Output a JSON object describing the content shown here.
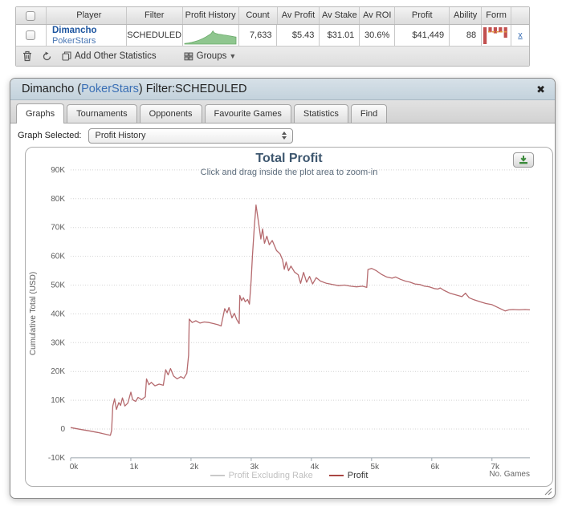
{
  "table": {
    "columns": [
      "Player",
      "Filter",
      "Profit History",
      "Count",
      "Av Profit",
      "Av Stake",
      "Av ROI",
      "Profit",
      "Ability",
      "Form"
    ],
    "row": {
      "player_name": "Dimancho",
      "site": "PokerStars",
      "filter": "SCHEDULED",
      "count": "7,633",
      "av_profit": "$5.43",
      "av_stake": "$31.01",
      "av_roi": "30.6%",
      "profit": "$41,449",
      "ability": "88",
      "remove_label": "x"
    },
    "toolbar": {
      "add_other_statistics": "Add Other Statistics",
      "groups": "Groups"
    },
    "sparkline": {
      "color_fill": "#8fc68f",
      "color_stroke": "#6aaa6a",
      "points": [
        [
          0,
          0.04
        ],
        [
          0.07,
          0.07
        ],
        [
          0.14,
          0.11
        ],
        [
          0.2,
          0.16
        ],
        [
          0.26,
          0.22
        ],
        [
          0.31,
          0.28
        ],
        [
          0.36,
          0.36
        ],
        [
          0.41,
          0.44
        ],
        [
          0.45,
          0.52
        ],
        [
          0.49,
          0.6
        ],
        [
          0.52,
          0.68
        ],
        [
          0.55,
          0.82
        ],
        [
          0.57,
          0.72
        ],
        [
          0.61,
          0.66
        ],
        [
          0.66,
          0.62
        ],
        [
          0.71,
          0.6
        ],
        [
          0.76,
          0.57
        ],
        [
          0.81,
          0.55
        ],
        [
          0.86,
          0.52
        ],
        [
          0.91,
          0.49
        ],
        [
          0.96,
          0.46
        ],
        [
          1,
          0.44
        ]
      ]
    },
    "form_chart": {
      "bar_color": "#c2504f",
      "dash_color": "#e39c3f",
      "bars": [
        1.0,
        0.3,
        0.36,
        0.3,
        0.62
      ],
      "dash_y": 0.27
    }
  },
  "dialog": {
    "title_prefix": "Dimancho (",
    "title_site": "PokerStars",
    "title_suffix": ") Filter:SCHEDULED",
    "close_label": "✖",
    "tabs": [
      {
        "label": "Graphs",
        "active": true
      },
      {
        "label": "Tournaments",
        "active": false
      },
      {
        "label": "Opponents",
        "active": false
      },
      {
        "label": "Favourite Games",
        "active": false
      },
      {
        "label": "Statistics",
        "active": false
      },
      {
        "label": "Find",
        "active": false
      }
    ],
    "graph_selected_label": "Graph Selected:",
    "graph_selected_value": "Profit History"
  },
  "chart_data": {
    "type": "line",
    "title": "Total Profit",
    "subtitle": "Click and drag inside the plot area to zoom-in",
    "ylabel": "Cumulative Total (USD)",
    "xlabel": "No. Games",
    "xlim": [
      0,
      7.63
    ],
    "ylim": [
      -10,
      90
    ],
    "x_ticks": [
      {
        "value": 0,
        "label": "0k"
      },
      {
        "value": 1,
        "label": "1k"
      },
      {
        "value": 2,
        "label": "2k"
      },
      {
        "value": 3,
        "label": "3k"
      },
      {
        "value": 4,
        "label": "4k"
      },
      {
        "value": 5,
        "label": "5k"
      },
      {
        "value": 6,
        "label": "6k"
      },
      {
        "value": 7,
        "label": "7k"
      }
    ],
    "y_ticks": [
      {
        "value": 90,
        "label": "90K"
      },
      {
        "value": 80,
        "label": "80K"
      },
      {
        "value": 70,
        "label": "70K"
      },
      {
        "value": 60,
        "label": "60K"
      },
      {
        "value": 50,
        "label": "50K"
      },
      {
        "value": 40,
        "label": "40K"
      },
      {
        "value": 30,
        "label": "30K"
      },
      {
        "value": 20,
        "label": "20K"
      },
      {
        "value": 10,
        "label": "10K"
      },
      {
        "value": 0,
        "label": "0"
      },
      {
        "value": -10,
        "label": "-10K"
      }
    ],
    "grid": true,
    "legend_position": "bottom",
    "legend": [
      {
        "name": "Profit Excluding Rake",
        "color": "#c9c9c9",
        "text_color": "#c0c0c0",
        "enabled": false
      },
      {
        "name": "Profit",
        "color": "#AA4643",
        "text_color": "#333333",
        "enabled": true
      }
    ],
    "series": [
      {
        "name": "Profit",
        "color": "#b56a6e",
        "points": [
          [
            0,
            0.5
          ],
          [
            0.08,
            0.2
          ],
          [
            0.18,
            -0.2
          ],
          [
            0.3,
            -0.6
          ],
          [
            0.45,
            -1.2
          ],
          [
            0.58,
            -1.8
          ],
          [
            0.66,
            -2.2
          ],
          [
            0.68,
            -0.5
          ],
          [
            0.7,
            8.0
          ],
          [
            0.73,
            10.5
          ],
          [
            0.76,
            6.8
          ],
          [
            0.8,
            9.2
          ],
          [
            0.83,
            8.2
          ],
          [
            0.86,
            10.8
          ],
          [
            0.9,
            8.0
          ],
          [
            0.95,
            9.0
          ],
          [
            1.0,
            12.8
          ],
          [
            1.03,
            10.2
          ],
          [
            1.08,
            9.6
          ],
          [
            1.12,
            11.0
          ],
          [
            1.18,
            10.2
          ],
          [
            1.24,
            11.2
          ],
          [
            1.26,
            17.4
          ],
          [
            1.3,
            15.4
          ],
          [
            1.34,
            16.2
          ],
          [
            1.4,
            15.0
          ],
          [
            1.47,
            15.6
          ],
          [
            1.54,
            15.2
          ],
          [
            1.58,
            20.6
          ],
          [
            1.62,
            18.8
          ],
          [
            1.66,
            21.0
          ],
          [
            1.71,
            18.4
          ],
          [
            1.77,
            17.4
          ],
          [
            1.83,
            18.2
          ],
          [
            1.88,
            17.6
          ],
          [
            1.93,
            19.4
          ],
          [
            1.96,
            25.6
          ],
          [
            1.97,
            38.2
          ],
          [
            2.02,
            37.0
          ],
          [
            2.08,
            37.6
          ],
          [
            2.15,
            36.8
          ],
          [
            2.22,
            37.2
          ],
          [
            2.3,
            37.0
          ],
          [
            2.38,
            36.6
          ],
          [
            2.45,
            36.2
          ],
          [
            2.5,
            35.8
          ],
          [
            2.56,
            41.8
          ],
          [
            2.6,
            40.4
          ],
          [
            2.63,
            42.2
          ],
          [
            2.68,
            38.6
          ],
          [
            2.72,
            40.2
          ],
          [
            2.76,
            38.0
          ],
          [
            2.8,
            36.6
          ],
          [
            2.81,
            46.4
          ],
          [
            2.84,
            44.6
          ],
          [
            2.87,
            45.6
          ],
          [
            2.9,
            44.2
          ],
          [
            2.94,
            45.0
          ],
          [
            2.97,
            43.4
          ],
          [
            3.0,
            52.0
          ],
          [
            3.02,
            60.0
          ],
          [
            3.05,
            70.0
          ],
          [
            3.08,
            77.8
          ],
          [
            3.12,
            72.0
          ],
          [
            3.16,
            66.0
          ],
          [
            3.19,
            69.5
          ],
          [
            3.22,
            64.5
          ],
          [
            3.26,
            67.0
          ],
          [
            3.3,
            64.0
          ],
          [
            3.35,
            65.5
          ],
          [
            3.42,
            62.0
          ],
          [
            3.48,
            60.8
          ],
          [
            3.52,
            58.8
          ],
          [
            3.55,
            55.5
          ],
          [
            3.58,
            58.0
          ],
          [
            3.62,
            55.0
          ],
          [
            3.66,
            56.6
          ],
          [
            3.72,
            54.5
          ],
          [
            3.78,
            53.6
          ],
          [
            3.82,
            50.6
          ],
          [
            3.87,
            54.4
          ],
          [
            3.92,
            51.0
          ],
          [
            3.97,
            53.0
          ],
          [
            4.02,
            50.4
          ],
          [
            4.08,
            52.6
          ],
          [
            4.15,
            51.4
          ],
          [
            4.25,
            50.6
          ],
          [
            4.35,
            50.2
          ],
          [
            4.45,
            49.8
          ],
          [
            4.55,
            50.0
          ],
          [
            4.65,
            49.6
          ],
          [
            4.75,
            49.4
          ],
          [
            4.85,
            49.6
          ],
          [
            4.92,
            49.2
          ],
          [
            4.94,
            55.4
          ],
          [
            5.0,
            55.8
          ],
          [
            5.08,
            55.0
          ],
          [
            5.16,
            53.8
          ],
          [
            5.25,
            52.8
          ],
          [
            5.34,
            52.4
          ],
          [
            5.4,
            52.8
          ],
          [
            5.48,
            52.0
          ],
          [
            5.56,
            51.4
          ],
          [
            5.64,
            51.0
          ],
          [
            5.72,
            50.4
          ],
          [
            5.8,
            50.2
          ],
          [
            5.88,
            49.6
          ],
          [
            5.96,
            49.4
          ],
          [
            6.04,
            48.8
          ],
          [
            6.1,
            48.6
          ],
          [
            6.14,
            49.0
          ],
          [
            6.2,
            48.2
          ],
          [
            6.3,
            47.2
          ],
          [
            6.4,
            46.6
          ],
          [
            6.5,
            46.0
          ],
          [
            6.56,
            47.2
          ],
          [
            6.62,
            45.6
          ],
          [
            6.7,
            44.9
          ],
          [
            6.8,
            44.2
          ],
          [
            6.9,
            43.6
          ],
          [
            7.0,
            43.2
          ],
          [
            7.08,
            42.4
          ],
          [
            7.16,
            41.6
          ],
          [
            7.22,
            41.0
          ],
          [
            7.28,
            41.4
          ],
          [
            7.35,
            41.5
          ],
          [
            7.45,
            41.4
          ],
          [
            7.55,
            41.5
          ],
          [
            7.63,
            41.4
          ]
        ]
      }
    ]
  },
  "colors": {
    "grid": "#d4d4d4",
    "axis": "#9aa4ac",
    "tick_text": "#5c5c5c",
    "download_green": "#3d8b3d"
  }
}
